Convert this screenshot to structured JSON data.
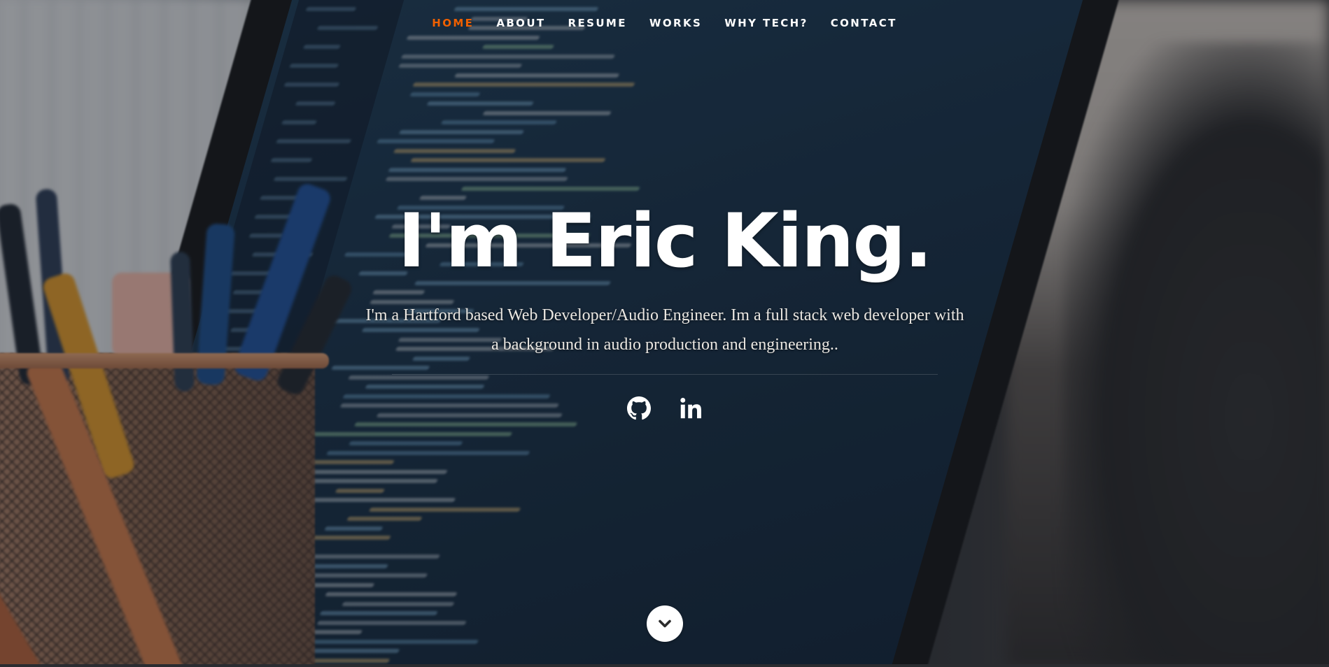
{
  "nav": {
    "items": [
      {
        "label": "HOME",
        "active": true
      },
      {
        "label": "ABOUT",
        "active": false
      },
      {
        "label": "RESUME",
        "active": false
      },
      {
        "label": "WORKS",
        "active": false
      },
      {
        "label": "WHY TECH?",
        "active": false
      },
      {
        "label": "CONTACT",
        "active": false
      }
    ],
    "active_color": "#F06000"
  },
  "banner": {
    "headline": "I'm Eric King.",
    "description": "I'm a Hartford based Web Developer/Audio Engineer. Im a full stack web developer with a background in audio production and engineering.."
  },
  "social": {
    "icons": [
      "github-icon",
      "linkedin-icon"
    ]
  },
  "scroll": {
    "icon": "chevron-down-icon"
  }
}
